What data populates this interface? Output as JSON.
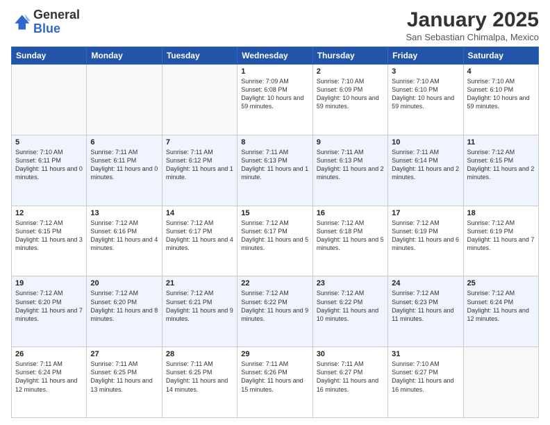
{
  "header": {
    "logo_general": "General",
    "logo_blue": "Blue",
    "month_title": "January 2025",
    "location": "San Sebastian Chimalpa, Mexico"
  },
  "days_of_week": [
    "Sunday",
    "Monday",
    "Tuesday",
    "Wednesday",
    "Thursday",
    "Friday",
    "Saturday"
  ],
  "weeks": [
    [
      {
        "day": "",
        "text": ""
      },
      {
        "day": "",
        "text": ""
      },
      {
        "day": "",
        "text": ""
      },
      {
        "day": "1",
        "text": "Sunrise: 7:09 AM\nSunset: 6:08 PM\nDaylight: 10 hours and 59 minutes."
      },
      {
        "day": "2",
        "text": "Sunrise: 7:10 AM\nSunset: 6:09 PM\nDaylight: 10 hours and 59 minutes."
      },
      {
        "day": "3",
        "text": "Sunrise: 7:10 AM\nSunset: 6:10 PM\nDaylight: 10 hours and 59 minutes."
      },
      {
        "day": "4",
        "text": "Sunrise: 7:10 AM\nSunset: 6:10 PM\nDaylight: 10 hours and 59 minutes."
      }
    ],
    [
      {
        "day": "5",
        "text": "Sunrise: 7:10 AM\nSunset: 6:11 PM\nDaylight: 11 hours and 0 minutes."
      },
      {
        "day": "6",
        "text": "Sunrise: 7:11 AM\nSunset: 6:11 PM\nDaylight: 11 hours and 0 minutes."
      },
      {
        "day": "7",
        "text": "Sunrise: 7:11 AM\nSunset: 6:12 PM\nDaylight: 11 hours and 1 minute."
      },
      {
        "day": "8",
        "text": "Sunrise: 7:11 AM\nSunset: 6:13 PM\nDaylight: 11 hours and 1 minute."
      },
      {
        "day": "9",
        "text": "Sunrise: 7:11 AM\nSunset: 6:13 PM\nDaylight: 11 hours and 2 minutes."
      },
      {
        "day": "10",
        "text": "Sunrise: 7:11 AM\nSunset: 6:14 PM\nDaylight: 11 hours and 2 minutes."
      },
      {
        "day": "11",
        "text": "Sunrise: 7:12 AM\nSunset: 6:15 PM\nDaylight: 11 hours and 2 minutes."
      }
    ],
    [
      {
        "day": "12",
        "text": "Sunrise: 7:12 AM\nSunset: 6:15 PM\nDaylight: 11 hours and 3 minutes."
      },
      {
        "day": "13",
        "text": "Sunrise: 7:12 AM\nSunset: 6:16 PM\nDaylight: 11 hours and 4 minutes."
      },
      {
        "day": "14",
        "text": "Sunrise: 7:12 AM\nSunset: 6:17 PM\nDaylight: 11 hours and 4 minutes."
      },
      {
        "day": "15",
        "text": "Sunrise: 7:12 AM\nSunset: 6:17 PM\nDaylight: 11 hours and 5 minutes."
      },
      {
        "day": "16",
        "text": "Sunrise: 7:12 AM\nSunset: 6:18 PM\nDaylight: 11 hours and 5 minutes."
      },
      {
        "day": "17",
        "text": "Sunrise: 7:12 AM\nSunset: 6:19 PM\nDaylight: 11 hours and 6 minutes."
      },
      {
        "day": "18",
        "text": "Sunrise: 7:12 AM\nSunset: 6:19 PM\nDaylight: 11 hours and 7 minutes."
      }
    ],
    [
      {
        "day": "19",
        "text": "Sunrise: 7:12 AM\nSunset: 6:20 PM\nDaylight: 11 hours and 7 minutes."
      },
      {
        "day": "20",
        "text": "Sunrise: 7:12 AM\nSunset: 6:20 PM\nDaylight: 11 hours and 8 minutes."
      },
      {
        "day": "21",
        "text": "Sunrise: 7:12 AM\nSunset: 6:21 PM\nDaylight: 11 hours and 9 minutes."
      },
      {
        "day": "22",
        "text": "Sunrise: 7:12 AM\nSunset: 6:22 PM\nDaylight: 11 hours and 9 minutes."
      },
      {
        "day": "23",
        "text": "Sunrise: 7:12 AM\nSunset: 6:22 PM\nDaylight: 11 hours and 10 minutes."
      },
      {
        "day": "24",
        "text": "Sunrise: 7:12 AM\nSunset: 6:23 PM\nDaylight: 11 hours and 11 minutes."
      },
      {
        "day": "25",
        "text": "Sunrise: 7:12 AM\nSunset: 6:24 PM\nDaylight: 11 hours and 12 minutes."
      }
    ],
    [
      {
        "day": "26",
        "text": "Sunrise: 7:11 AM\nSunset: 6:24 PM\nDaylight: 11 hours and 12 minutes."
      },
      {
        "day": "27",
        "text": "Sunrise: 7:11 AM\nSunset: 6:25 PM\nDaylight: 11 hours and 13 minutes."
      },
      {
        "day": "28",
        "text": "Sunrise: 7:11 AM\nSunset: 6:25 PM\nDaylight: 11 hours and 14 minutes."
      },
      {
        "day": "29",
        "text": "Sunrise: 7:11 AM\nSunset: 6:26 PM\nDaylight: 11 hours and 15 minutes."
      },
      {
        "day": "30",
        "text": "Sunrise: 7:11 AM\nSunset: 6:27 PM\nDaylight: 11 hours and 16 minutes."
      },
      {
        "day": "31",
        "text": "Sunrise: 7:10 AM\nSunset: 6:27 PM\nDaylight: 11 hours and 16 minutes."
      },
      {
        "day": "",
        "text": ""
      }
    ]
  ]
}
